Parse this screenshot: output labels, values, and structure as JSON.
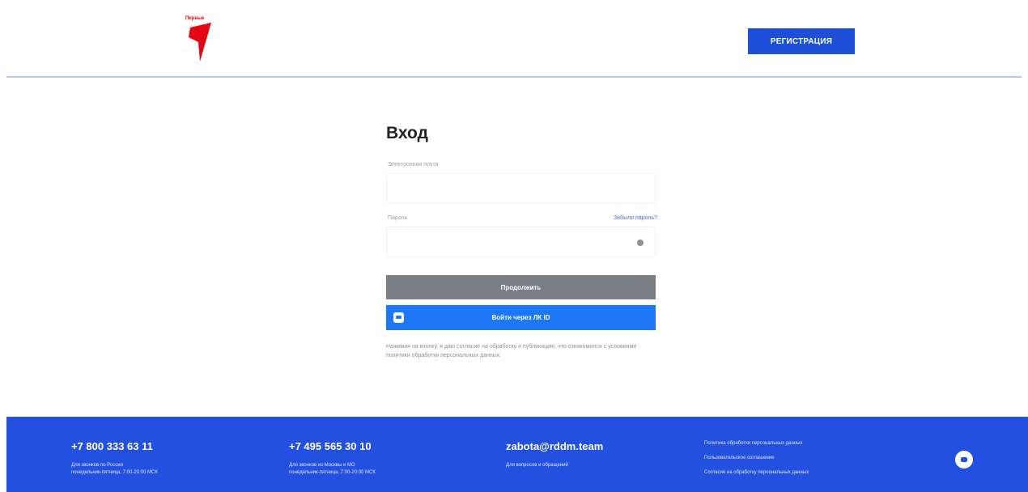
{
  "header": {
    "logo_text": "Первые",
    "register_label": "РЕГИСТРАЦИЯ"
  },
  "form": {
    "title": "Вход",
    "email_label": "Электронная почта",
    "email_value": "",
    "password_label": "Пароль",
    "forgot_label": "Забыли пароль?",
    "password_value": "",
    "continue_label": "Продолжить",
    "sso_label": "Войти через ЛК ID",
    "consent_text": "Нажимая на кнопку, я даю согласие на обработку и публикацию, что ознакомился с условиями политики обработки персональных данных"
  },
  "footer": {
    "col1": {
      "phone": "+7 800 333 63 11",
      "line1": "Для звонков по России",
      "line2": "понедельник-пятница, 7:00-20:00 МСК"
    },
    "col2": {
      "phone": "+7 495 565 30 10",
      "line1": "Для звонков из Москвы и МО",
      "line2": "понедельник-пятница, 7:00-20:00 МСК"
    },
    "col3": {
      "email": "zabota@rddm.team",
      "line1": "Для вопросов и обращений"
    },
    "links": [
      "Политика обработки персональных данных",
      "Пользовательское соглашение",
      "Согласие на обработку персональных данных"
    ],
    "social_icon": "vk-icon"
  },
  "colors": {
    "accent": "#1e4fd8",
    "footer_bg": "#2450e0",
    "sso_bg": "#1e78f5",
    "continue_bg": "#7a7f85",
    "logo_red": "#e30613"
  }
}
